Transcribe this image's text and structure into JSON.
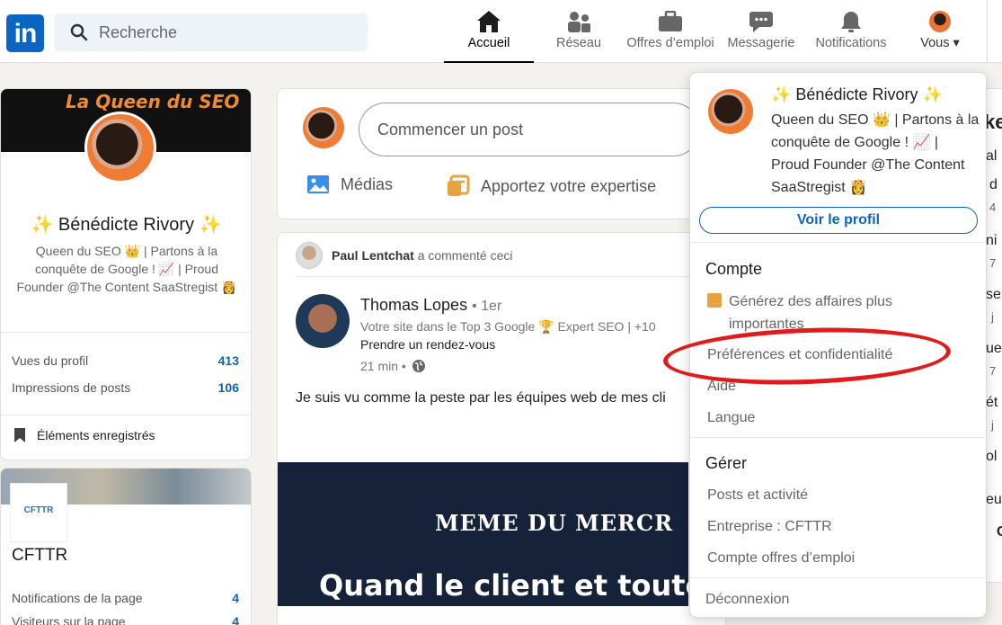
{
  "nav": {
    "logo_text": "in",
    "search_placeholder": "Recherche",
    "items": [
      {
        "label": "Accueil",
        "icon": "home-icon"
      },
      {
        "label": "Réseau",
        "icon": "network-icon"
      },
      {
        "label": "Offres d’emploi",
        "icon": "briefcase-icon"
      },
      {
        "label": "Messagerie",
        "icon": "message-icon"
      },
      {
        "label": "Notifications",
        "icon": "bell-icon"
      },
      {
        "label": "Vous",
        "icon": "avatar"
      }
    ]
  },
  "profile_card": {
    "banner_text": "La Queen du SEO",
    "name": "✨ Bénédicte Rivory ✨",
    "headline": "Queen du SEO 👑 | Partons à la conquête de Google ! 📈 | Proud Founder @The Content SaaStregist 👸",
    "stats": [
      {
        "label": "Vues du profil",
        "value": "413"
      },
      {
        "label": "Impressions de posts",
        "value": "106"
      }
    ],
    "saved_label": "Éléments enregistrés"
  },
  "company_card": {
    "logo_text": "CFTTR",
    "name": "CFTTR",
    "rows": [
      {
        "label": "Notifications de la page",
        "value": "4"
      },
      {
        "label": "Visiteurs sur la page",
        "value": "4"
      }
    ]
  },
  "composer": {
    "placeholder": "Commencer un post",
    "actions": [
      {
        "label": "Médias",
        "icon": "image-icon"
      },
      {
        "label": "Apportez votre expertise",
        "icon": "article-icon"
      }
    ]
  },
  "feed_post": {
    "activity_actor": "Paul Lentchat",
    "activity_text": "a commenté ceci",
    "author": "Thomas Lopes",
    "degree": "• 1er",
    "author_headline": "Votre site dans le Top 3 Google 🏆 Expert SEO | +10",
    "cta": "Prendre un rendez-vous",
    "time": "21 min •",
    "text": "Je suis vu comme la peste par les équipes web de mes cli",
    "meme_line1": "MEME DU MERCR",
    "meme_line2": "Quand le client et toute l’équipe"
  },
  "dropdown": {
    "name": "✨ Bénédicte Rivory ✨",
    "headline": "Queen du SEO 👑 | Partons à la conquête de Google ! 📈 | Proud Founder @The Content SaaStregist 👸",
    "view_profile": "Voir le profil",
    "account_title": "Compte",
    "premium_text": "Générez des affaires plus importantes",
    "account_links": [
      "Préférences et confidentialité",
      "Aide",
      "Langue"
    ],
    "manage_title": "Gérer",
    "manage_links": [
      "Posts et activité",
      "Entreprise : CFTTR",
      "Compte offres d’emploi"
    ],
    "logout": "Déconnexion"
  },
  "right_partial": [
    "ke",
    "al",
    "d",
    "4",
    "ni",
    "7",
    "se",
    "j",
    "ue",
    "7",
    "ét",
    "j",
    "ol",
    "eu",
    "C"
  ]
}
